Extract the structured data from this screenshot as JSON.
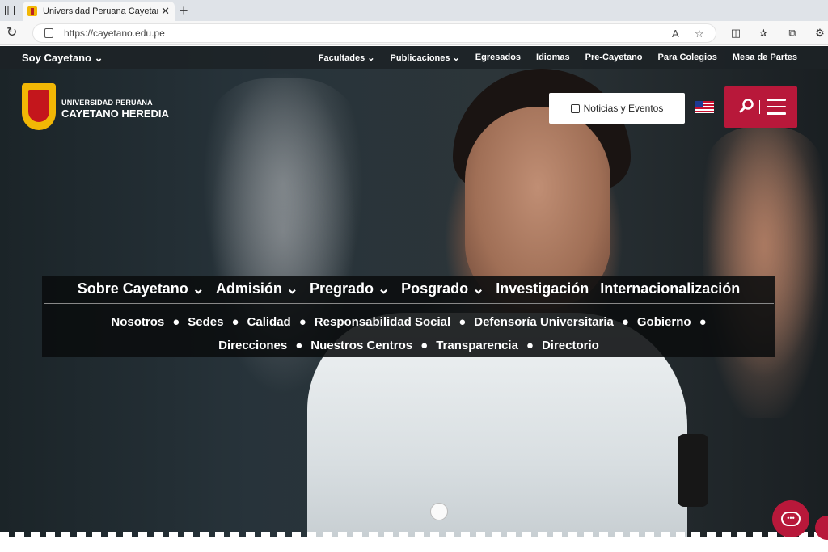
{
  "browser": {
    "tab_title": "Universidad Peruana Cayetano H",
    "url": "https://cayetano.edu.pe"
  },
  "topnav": {
    "soy": "Soy Cayetano",
    "links": [
      "Facultades",
      "Publicaciones",
      "Egresados",
      "Idiomas",
      "Pre-Cayetano",
      "Para Colegios",
      "Mesa de Partes"
    ]
  },
  "logo": {
    "line1": "UNIVERSIDAD PERUANA",
    "line2": "CAYETANO HEREDIA"
  },
  "header": {
    "news_label": "Noticias y Eventos"
  },
  "mainnav": {
    "primary": [
      "Sobre Cayetano",
      "Admisión",
      "Pregrado",
      "Posgrado",
      "Investigación",
      "Internacionalización"
    ],
    "secondary_row1": [
      "Nosotros",
      "Sedes",
      "Calidad",
      "Responsabilidad Social",
      "Defensoría Universitaria",
      "Gobierno"
    ],
    "secondary_row2": [
      "Direcciones",
      "Nuestros Centros",
      "Transparencia",
      "Directorio"
    ]
  },
  "colors": {
    "accent": "#b8183a",
    "brand_yellow": "#f2b705"
  }
}
